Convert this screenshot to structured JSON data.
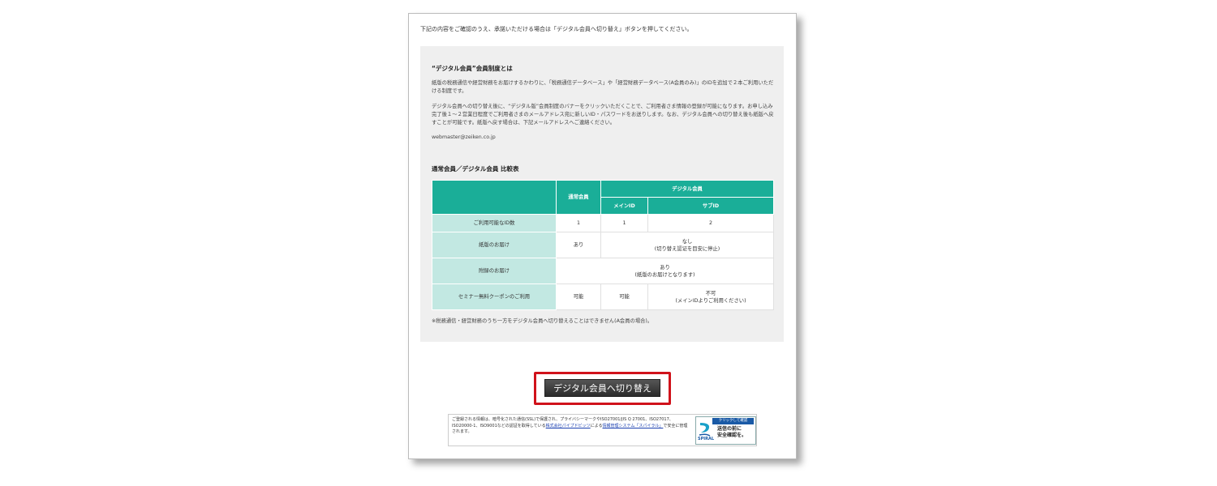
{
  "intro": "下記の内容をご確認のうえ、承諾いただける場合は「デジタル会員へ切り替え」ボタンを押してください。",
  "about": {
    "title": "“デジタル会員”会員制度とは",
    "paragraph1": "紙版の税務通信や経営財務をお届けするかわりに、「税務通信データベース」や「経営財務データベース(A会員のみ)」のIDを追加で２本ご利用いただける制度です。",
    "paragraph2": "デジタル会員への切り替え後に、“デジタル版”会員制度のバナーをクリックいただくことで、ご利用者さま情報の登録が可能になります。お申し込み完了後１～２営業日程度でご利用者さまのメールアドレス宛に新しいID・パスワードをお送りします。なお、デジタル会員への切り替え後も紙版へ戻すことが可能です。紙版へ戻す場合は、下記メールアドレスへご連絡ください。",
    "email": "webmaster@zeiken.co.jp"
  },
  "comparison": {
    "title": "通常会員／デジタル会員 比較表",
    "headers": {
      "regular": "通常会員",
      "digital": "デジタル会員",
      "main_id": "メインID",
      "sub_id": "サブID"
    },
    "rows": [
      {
        "label": "ご利用可能なID数",
        "regular": "1",
        "main": "1",
        "sub": "2"
      },
      {
        "label": "紙版のお届け",
        "regular": "あり",
        "digital_line1": "なし",
        "digital_line2": "(切り替え認证を目安に停止)"
      },
      {
        "label": "附録のお届け",
        "all_line1": "あり",
        "all_line2": "(紙版のお届けとなります)"
      },
      {
        "label": "セミナー無料クーポンのご利用",
        "regular": "可能",
        "main": "可能",
        "sub_line1": "不可",
        "sub_line2": "(メインIDよりご利用ください)"
      }
    ],
    "note": "※税務通信・経営財務のうち一方をデジタル会員へ切り替えることはできません(A会員の場合)。"
  },
  "switch_button": "デジタル会員へ切り替え",
  "security": {
    "text_before": "ご登録される情報は、暗号化された通信(SSL)で保護され、プライバシーマークやISO27001/JIS Q 27001、ISO27017、ISO20000-1、ISO9001などの認証を取得している",
    "link1": "株式会社パイプドビッツ",
    "text_mid": "による",
    "link2": "情報管理システム「スパイラル」",
    "text_after": "で安全に管理されます。",
    "badge_top": "クリックして確認",
    "badge_main_line1": "送信の前に",
    "badge_main_line2": "安全確認を。",
    "badge_name": "SPIRAL"
  },
  "colors": {
    "header_teal": "#1aae98",
    "row_header_light": "#c2e8e2",
    "highlight_red": "#d0121b",
    "button_dark": "#3a3a3a"
  }
}
